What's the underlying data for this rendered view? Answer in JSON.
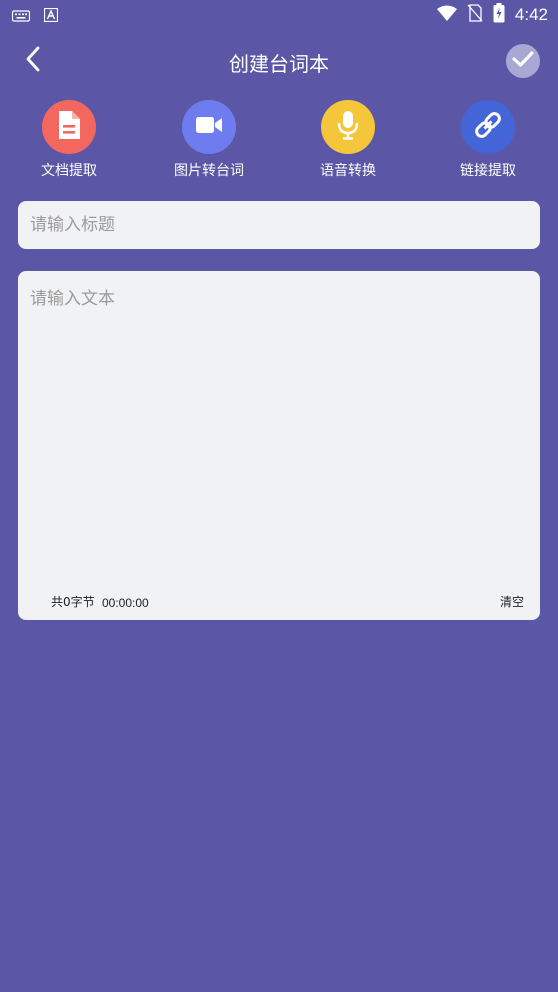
{
  "status_bar": {
    "time": "4:42",
    "icons": [
      "keyboard-icon",
      "app-a-icon",
      "wifi-icon",
      "no-sim-icon",
      "battery-charging-icon"
    ]
  },
  "header": {
    "title": "创建台词本",
    "back_icon": "chevron-left-icon",
    "confirm_icon": "check-icon"
  },
  "tools": [
    {
      "label": "文档提取",
      "icon": "document-icon",
      "color": "#f4675e"
    },
    {
      "label": "图片转台词",
      "icon": "video-camera-icon",
      "color": "#6e7cf0"
    },
    {
      "label": "语音转换",
      "icon": "microphone-icon",
      "color": "#f6c63a"
    },
    {
      "label": "链接提取",
      "icon": "link-icon",
      "color": "#4365d8"
    }
  ],
  "title_input": {
    "placeholder": "请输入标题",
    "value": ""
  },
  "text_input": {
    "placeholder": "请输入文本",
    "value": ""
  },
  "footer": {
    "byte_count": "共0字节",
    "duration": "00:00:00",
    "clear_label": "清空"
  },
  "colors": {
    "background": "#5b57a6",
    "input_background": "#f1f2f4",
    "confirm_button": "#a9a7d3"
  }
}
